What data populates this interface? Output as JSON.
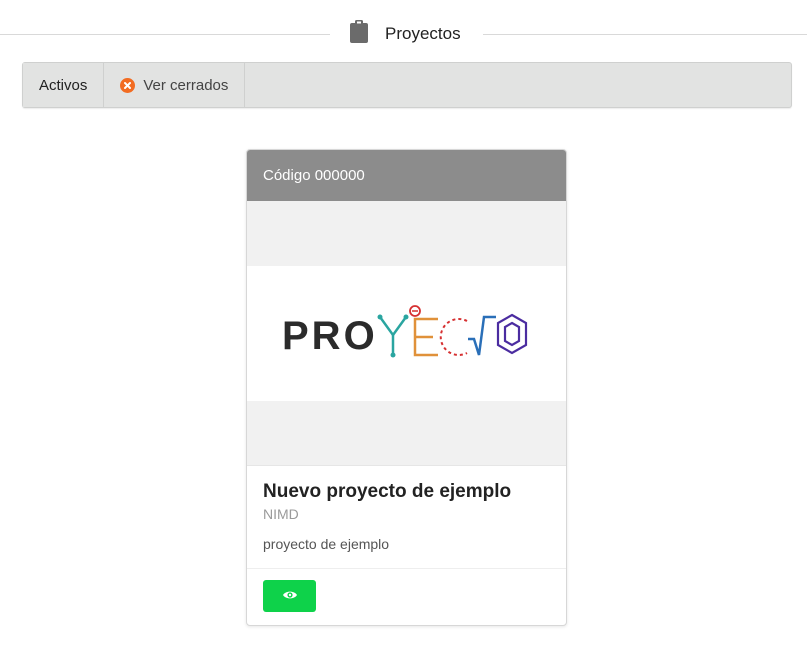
{
  "header": {
    "title": "Proyectos",
    "icon": "clipboard-icon"
  },
  "tabs": [
    {
      "label": "Activos",
      "active": true
    },
    {
      "label": "Ver cerrados",
      "icon": "close-circle-icon",
      "icon_color": "#f26c22"
    }
  ],
  "project": {
    "code": "Código 000000",
    "logo_text": "PROYECTO",
    "name": "Nuevo proyecto de ejemplo",
    "organization": "NIMD",
    "description": "proyecto de ejemplo",
    "action_icon": "eye-icon",
    "action_color": "#0ed24a"
  }
}
